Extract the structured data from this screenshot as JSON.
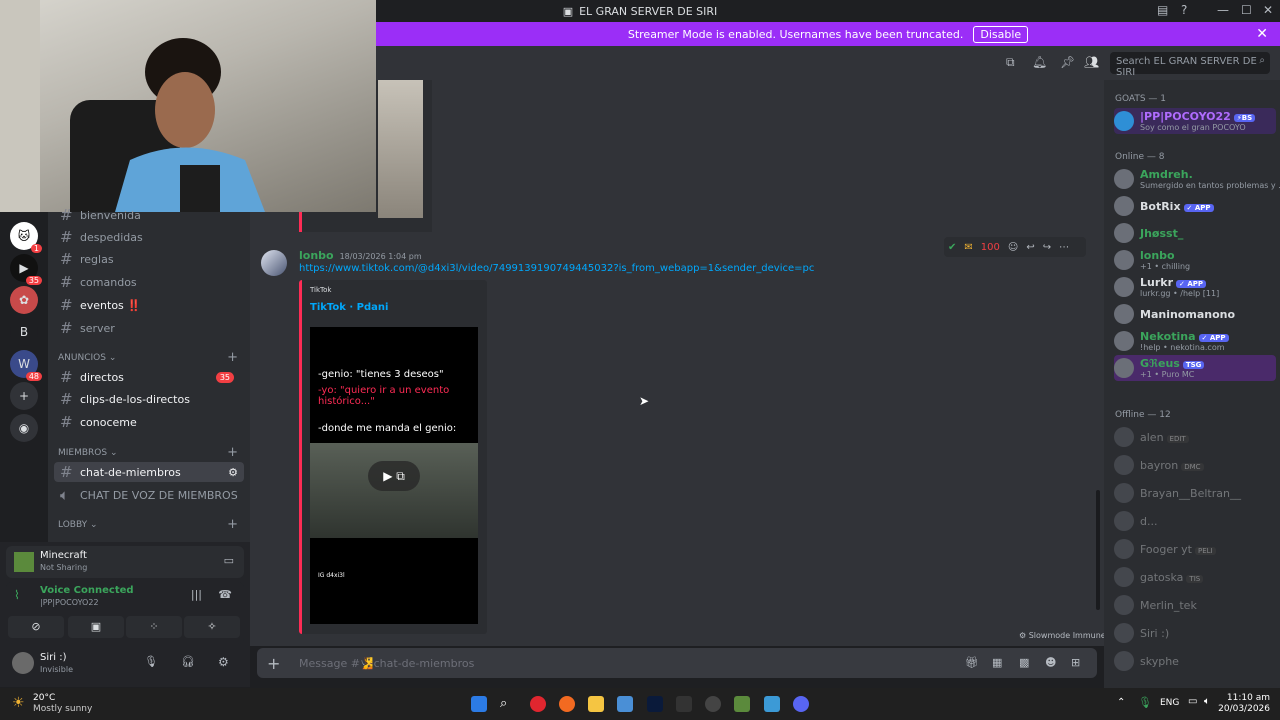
{
  "window": {
    "title": "EL GRAN SERVER DE SIRI"
  },
  "banner": {
    "text": "Streamer Mode is enabled. Usernames have been truncated.",
    "button": "Disable"
  },
  "header": {
    "search_placeholder": "Search EL GRAN SERVER DE SIRI"
  },
  "channels": {
    "items": [
      "bienvenida",
      "despedidas",
      "reglas",
      "comandos",
      "eventos ‼️",
      "server"
    ],
    "cat_anuncios": "ANUNCIOS",
    "anuncios": [
      "directos",
      "clips-de-los-directos",
      "conoceme"
    ],
    "directos_badge": "35",
    "cat_miembros": "MIEMBROS",
    "miembros": [
      "chat-de-miembros",
      "CHAT DE VOZ DE MIEMBROS"
    ],
    "cat_lobby": "LOBBY"
  },
  "panel": {
    "activity_title": "Minecraft",
    "activity_sub": "Not Sharing",
    "voice_title": "Voice Connected",
    "voice_sub": "|PP|POCOYO22",
    "user_name": "Siri :)",
    "user_status": "Invisible"
  },
  "message": {
    "username": "lonbo",
    "timestamp": "18/03/2026 1:04 pm",
    "link": "https://www.tiktok.com/@d4xi3l/video/7499139190749445032?is_from_webapp=1&sender_device=pc",
    "embed_provider": "TikTok",
    "embed_title": "TikTok · Pdani",
    "embed_line1": "-genio: \"tienes 3 deseos\"",
    "embed_line2": "-yo: \"quiero ir a un evento histórico...\"",
    "embed_line3": "-donde me manda el genio:",
    "embed_watermark": "IG d4xi3l"
  },
  "composer": {
    "placeholder": "Message #🧏chat-de-miembros",
    "slowmode": "Slowmode Immune"
  },
  "members": {
    "goats_header": "GOATS — 1",
    "goats": [
      {
        "name": "|PP|POCOYO22",
        "tag": "⚡BS",
        "status": "Soy como el gran POCOYO"
      }
    ],
    "online_header": "Online — 8",
    "online": [
      {
        "name": "Amdreh.",
        "tag": "",
        "status": "Sumergido en tantos problemas y ..."
      },
      {
        "name": "BotRix",
        "tag": "✓ APP",
        "status": ""
      },
      {
        "name": "Jhøsst_",
        "tag": "",
        "status": ""
      },
      {
        "name": "lonbo",
        "tag": "",
        "status": "+1 • chilling"
      },
      {
        "name": "Lurkr",
        "tag": "✓ APP",
        "status": "lurkr.gg • /help [11]"
      },
      {
        "name": "Maninomanono",
        "tag": "",
        "status": ""
      },
      {
        "name": "Nekotina",
        "tag": "✓ APP",
        "status": "!help • nekotina.com"
      },
      {
        "name": "Ǥℜeus",
        "tag": "TSG",
        "status": "+1 • Puro MC"
      }
    ],
    "offline_header": "Offline — 12",
    "offline": [
      {
        "name": "alen",
        "tag": "EDIT"
      },
      {
        "name": "bayron",
        "tag": "DMC"
      },
      {
        "name": "Brayan__Beltran__",
        "tag": ""
      },
      {
        "name": "d...",
        "tag": ""
      },
      {
        "name": "Fooger yt",
        "tag": "PELI"
      },
      {
        "name": "gatoska",
        "tag": "TIS"
      },
      {
        "name": "Merlin_tek",
        "tag": ""
      },
      {
        "name": "Siri :)",
        "tag": ""
      },
      {
        "name": "skyphe",
        "tag": ""
      }
    ]
  },
  "taskbar": {
    "weather_temp": "20°C",
    "weather_desc": "Mostly sunny",
    "lang": "ENG",
    "time": "11:10 am",
    "date": "20/03/2026"
  },
  "colors": {
    "accent": "#5865f2",
    "streamer_banner": "#9b2ef7",
    "online_green": "#3ba55c",
    "tiktok_red": "#fe2c55"
  }
}
